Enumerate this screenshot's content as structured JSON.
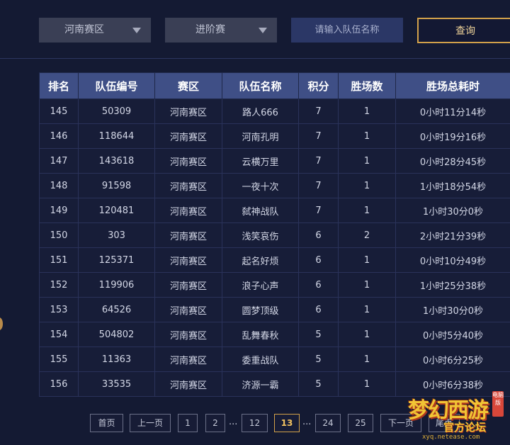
{
  "filters": {
    "region_select": "河南赛区",
    "stage_select": "进阶赛",
    "team_search_placeholder": "请输入队伍名称",
    "query_label": "查询"
  },
  "table": {
    "headers": [
      "排名",
      "队伍编号",
      "赛区",
      "队伍名称",
      "积分",
      "胜场数",
      "胜场总耗时"
    ],
    "rows": [
      [
        "145",
        "50309",
        "河南赛区",
        "路人666",
        "7",
        "1",
        "0小时11分14秒"
      ],
      [
        "146",
        "118644",
        "河南赛区",
        "河南孔明",
        "7",
        "1",
        "0小时19分16秒"
      ],
      [
        "147",
        "143618",
        "河南赛区",
        "云横万里",
        "7",
        "1",
        "0小时28分45秒"
      ],
      [
        "148",
        "91598",
        "河南赛区",
        "一夜十次",
        "7",
        "1",
        "1小时18分54秒"
      ],
      [
        "149",
        "120481",
        "河南赛区",
        "弑神战队",
        "7",
        "1",
        "1小时30分0秒"
      ],
      [
        "150",
        "303",
        "河南赛区",
        "浅笑哀伤",
        "6",
        "2",
        "2小时21分39秒"
      ],
      [
        "151",
        "125371",
        "河南赛区",
        "起名好烦",
        "6",
        "1",
        "0小时10分49秒"
      ],
      [
        "152",
        "119906",
        "河南赛区",
        "浪子心声",
        "6",
        "1",
        "1小时25分38秒"
      ],
      [
        "153",
        "64526",
        "河南赛区",
        "圆梦顶级",
        "6",
        "1",
        "1小时30分0秒"
      ],
      [
        "154",
        "504802",
        "河南赛区",
        "乱舞春秋",
        "5",
        "1",
        "0小时5分40秒"
      ],
      [
        "155",
        "11363",
        "河南赛区",
        "委重战队",
        "5",
        "1",
        "0小时6分25秒"
      ],
      [
        "156",
        "33535",
        "河南赛区",
        "济源一霸",
        "5",
        "1",
        "0小时6分38秒"
      ]
    ]
  },
  "pagination": {
    "first": "首页",
    "prev": "上一页",
    "pages": [
      "1",
      "2",
      "12",
      "13",
      "24",
      "25"
    ],
    "current": "13",
    "ellipsis": "...",
    "next": "下一页",
    "last": "尾页"
  },
  "watermark": {
    "title": "梦幻西游",
    "tag": "电脑版",
    "subtitle": "官方论坛",
    "url": "xyq.netease.com"
  },
  "colors": {
    "background": "#141a33",
    "header_bg": "#3f4f86",
    "accent_gold": "#d2a14a"
  }
}
